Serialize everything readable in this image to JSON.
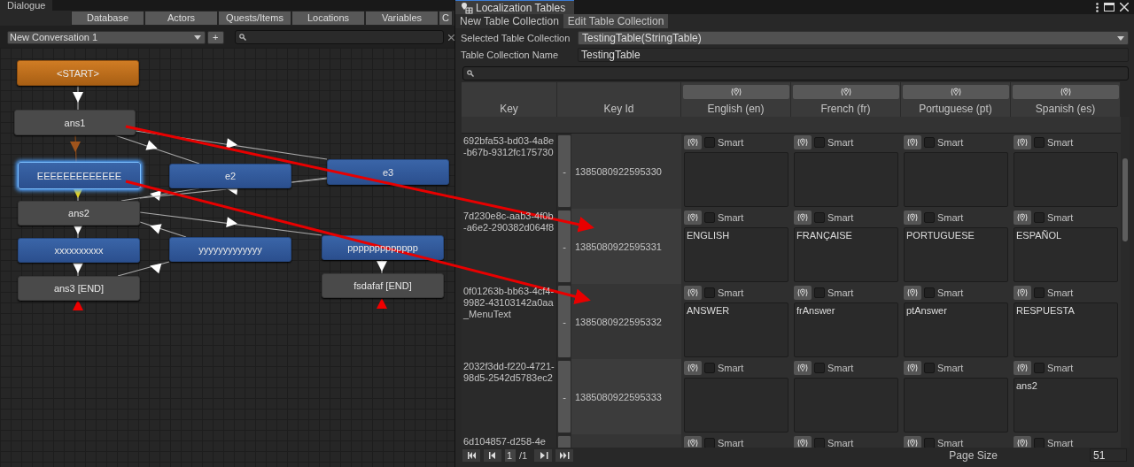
{
  "dialogue": {
    "title": "Dialogue",
    "tabs": [
      {
        "label": "Database"
      },
      {
        "label": "Actors"
      },
      {
        "label": "Quests/Items"
      },
      {
        "label": "Locations"
      },
      {
        "label": "Variables"
      },
      {
        "label": "C"
      }
    ],
    "conversation": "New Conversation 1",
    "add_button": "+",
    "nodes": [
      {
        "text": "<START>",
        "kind": "start",
        "selected": false
      },
      {
        "text": "ans1",
        "kind": "npc",
        "selected": false
      },
      {
        "text": "EEEEEEEEEEEEE",
        "kind": "player",
        "selected": true
      },
      {
        "text": "e2",
        "kind": "player",
        "selected": false
      },
      {
        "text": "e3",
        "kind": "player",
        "selected": false
      },
      {
        "text": "ans2",
        "kind": "npc",
        "selected": false
      },
      {
        "text": "xxxxxxxxxx",
        "kind": "player",
        "selected": false
      },
      {
        "text": "yyyyyyyyyyyyy",
        "kind": "player",
        "selected": false
      },
      {
        "text": "ppppppppppppp",
        "kind": "player",
        "selected": false
      },
      {
        "text": "ans3 [END]",
        "kind": "npc",
        "selected": false
      },
      {
        "text": "fsdafaf [END]",
        "kind": "npc",
        "selected": false
      }
    ]
  },
  "localization": {
    "title": "Localization Tables",
    "tabs": [
      {
        "label": "New Table Collection",
        "selected": false
      },
      {
        "label": "Edit Table Collection",
        "selected": true
      }
    ],
    "selected_collection_label": "Selected Table Collection",
    "selected_collection": "TestingTable(StringTable)",
    "name_label": "Table Collection Name",
    "name": "TestingTable",
    "columns": [
      "Key",
      "Key Id"
    ],
    "languages": [
      "English (en)",
      "French (fr)",
      "Portuguese (pt)",
      "Spanish (es)"
    ],
    "rows": [
      {
        "key": "692bfa53-bd03-4a8e-b67b-9312fc175730",
        "remove": "-",
        "key_id": "1385080922595330",
        "cells": [
          {
            "smart": false,
            "smart_label": "Smart"
          },
          {
            "smart": false,
            "smart_label": "Smart"
          },
          {
            "smart": false,
            "smart_label": "Smart"
          },
          {
            "smart": false,
            "smart_label": "Smart"
          }
        ]
      },
      {
        "key": "7d230e8c-aab3-4f0b-a6e2-290382d064f8",
        "remove": "-",
        "key_id": "1385080922595331",
        "cells": [
          {
            "smart": false,
            "smart_label": "Smart",
            "value": "ENGLISH"
          },
          {
            "smart": false,
            "smart_label": "Smart",
            "value": "FRANÇAISE"
          },
          {
            "smart": false,
            "smart_label": "Smart",
            "value": "PORTUGUESE"
          },
          {
            "smart": false,
            "smart_label": "Smart",
            "value": "ESPAÑOL"
          }
        ]
      },
      {
        "key": "0f01263b-bb63-4cf4-9982-43103142a0aa_MenuText",
        "remove": "-",
        "key_id": "1385080922595332",
        "cells": [
          {
            "smart": false,
            "smart_label": "Smart",
            "value": "ANSWER"
          },
          {
            "smart": false,
            "smart_label": "Smart",
            "value": "frAnswer"
          },
          {
            "smart": false,
            "smart_label": "Smart",
            "value": "ptAnswer"
          },
          {
            "smart": false,
            "smart_label": "Smart",
            "value": "RESPUESTA"
          }
        ]
      },
      {
        "key": "2032f3dd-f220-4721-98d5-2542d5783ec2",
        "remove": "-",
        "key_id": "1385080922595333",
        "cells": [
          {
            "smart": false,
            "smart_label": "Smart"
          },
          {
            "smart": false,
            "smart_label": "Smart"
          },
          {
            "smart": false,
            "smart_label": "Smart"
          },
          {
            "smart": false,
            "smart_label": "Smart",
            "value": "ans2"
          }
        ]
      },
      {
        "key": "6d104857-d258-4e",
        "cells": [
          {
            "smart": false,
            "smart_label": "Smart"
          },
          {
            "smart": false,
            "smart_label": "Smart"
          },
          {
            "smart": false,
            "smart_label": "Smart"
          },
          {
            "smart": false,
            "smart_label": "Smart"
          }
        ]
      }
    ],
    "pagination": {
      "page": "1",
      "total": "/1",
      "page_size_label": "Page Size",
      "page_size": "51"
    }
  }
}
